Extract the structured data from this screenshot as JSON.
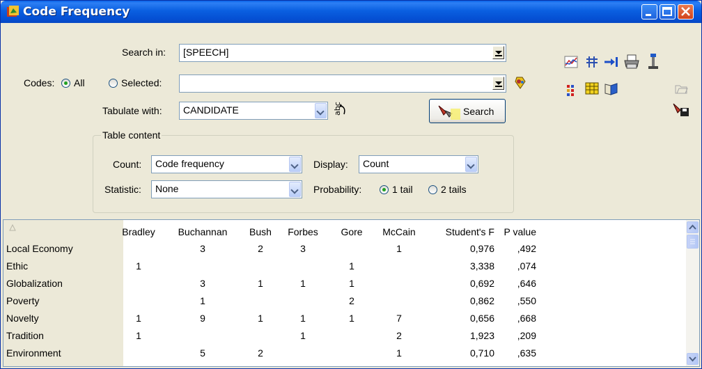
{
  "window": {
    "title": "Code Frequency"
  },
  "form": {
    "search_in_label": "Search in:",
    "search_in_value": "[SPEECH]",
    "codes_label": "Codes:",
    "codes_all_label": "All",
    "codes_selected_label": "Selected:",
    "selected_value": "",
    "tabulate_label": "Tabulate with:",
    "tabulate_value": "CANDIDATE",
    "search_button_label": "Search"
  },
  "table_content": {
    "group_title": "Table content",
    "count_label": "Count:",
    "count_value": "Code frequency",
    "display_label": "Display:",
    "display_value": "Count",
    "statistic_label": "Statistic:",
    "statistic_value": "None",
    "probability_label": "Probability:",
    "prob_1tail_label": "1 tail",
    "prob_2tails_label": "2 tails"
  },
  "toolbar_icons": [
    "chart-icon",
    "columns-icon",
    "export-icon",
    "print-icon",
    "tool-icon",
    "heatmap-icon",
    "grid-icon",
    "book-icon",
    "open-file-icon",
    "save-icon"
  ],
  "table": {
    "columns": [
      "Bradley",
      "Buchannan",
      "Bush",
      "Forbes",
      "Gore",
      "McCain",
      "Student's F",
      "P value"
    ],
    "rows": [
      {
        "label": "Local Economy",
        "cells": [
          "",
          "3",
          "2",
          "3",
          "",
          "1",
          "0,976",
          ",492"
        ]
      },
      {
        "label": "Ethic",
        "cells": [
          "1",
          "",
          "",
          "",
          "1",
          "",
          "3,338",
          ",074"
        ]
      },
      {
        "label": "Globalization",
        "cells": [
          "",
          "3",
          "1",
          "1",
          "1",
          "",
          "0,692",
          ",646"
        ]
      },
      {
        "label": "Poverty",
        "cells": [
          "",
          "1",
          "",
          "",
          "2",
          "",
          "0,862",
          ",550"
        ]
      },
      {
        "label": "Novelty",
        "cells": [
          "1",
          "9",
          "1",
          "1",
          "1",
          "7",
          "0,656",
          ",668"
        ]
      },
      {
        "label": "Tradition",
        "cells": [
          "1",
          "",
          "",
          "1",
          "",
          "2",
          "1,923",
          ",209"
        ]
      },
      {
        "label": "Environment",
        "cells": [
          "",
          "5",
          "2",
          "",
          "",
          "1",
          "0,710",
          ",635"
        ]
      }
    ]
  },
  "colors": {
    "titlebar": "#0a5fe0",
    "face": "#ece9d8",
    "radio_dot": "#21a121"
  }
}
